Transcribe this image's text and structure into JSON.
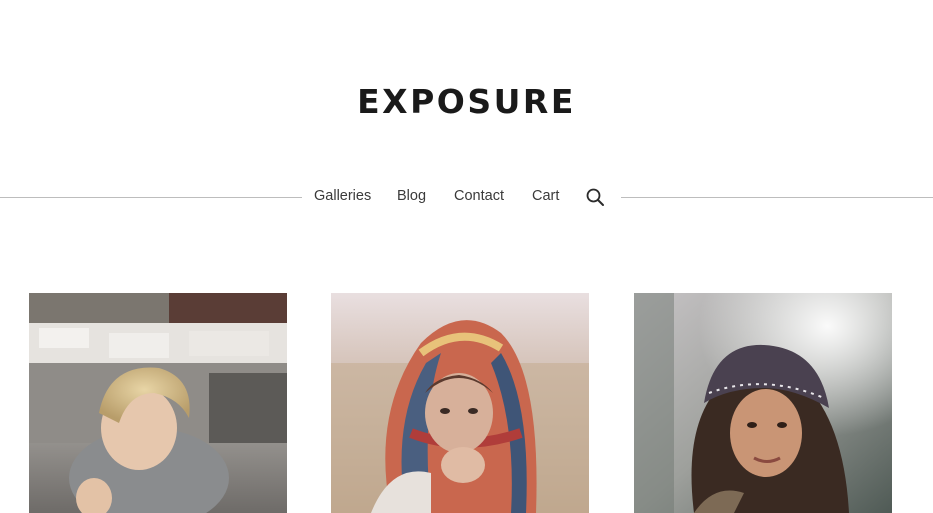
{
  "site": {
    "title": "EXPOSURE"
  },
  "nav": {
    "items": [
      {
        "label": "Galleries"
      },
      {
        "label": "Blog"
      },
      {
        "label": "Contact"
      },
      {
        "label": "Cart"
      }
    ],
    "search_icon": "search-icon"
  },
  "gallery": {
    "photos": [
      {
        "subject": "photo-woman-short-blonde-hair"
      },
      {
        "subject": "photo-woman-plaid-scarf"
      },
      {
        "subject": "photo-woman-knit-beanie"
      }
    ]
  },
  "colors": {
    "text": "#1a1a1a",
    "nav_text": "#3a3a3a",
    "divider": "#bdbdbd",
    "background": "#ffffff"
  }
}
